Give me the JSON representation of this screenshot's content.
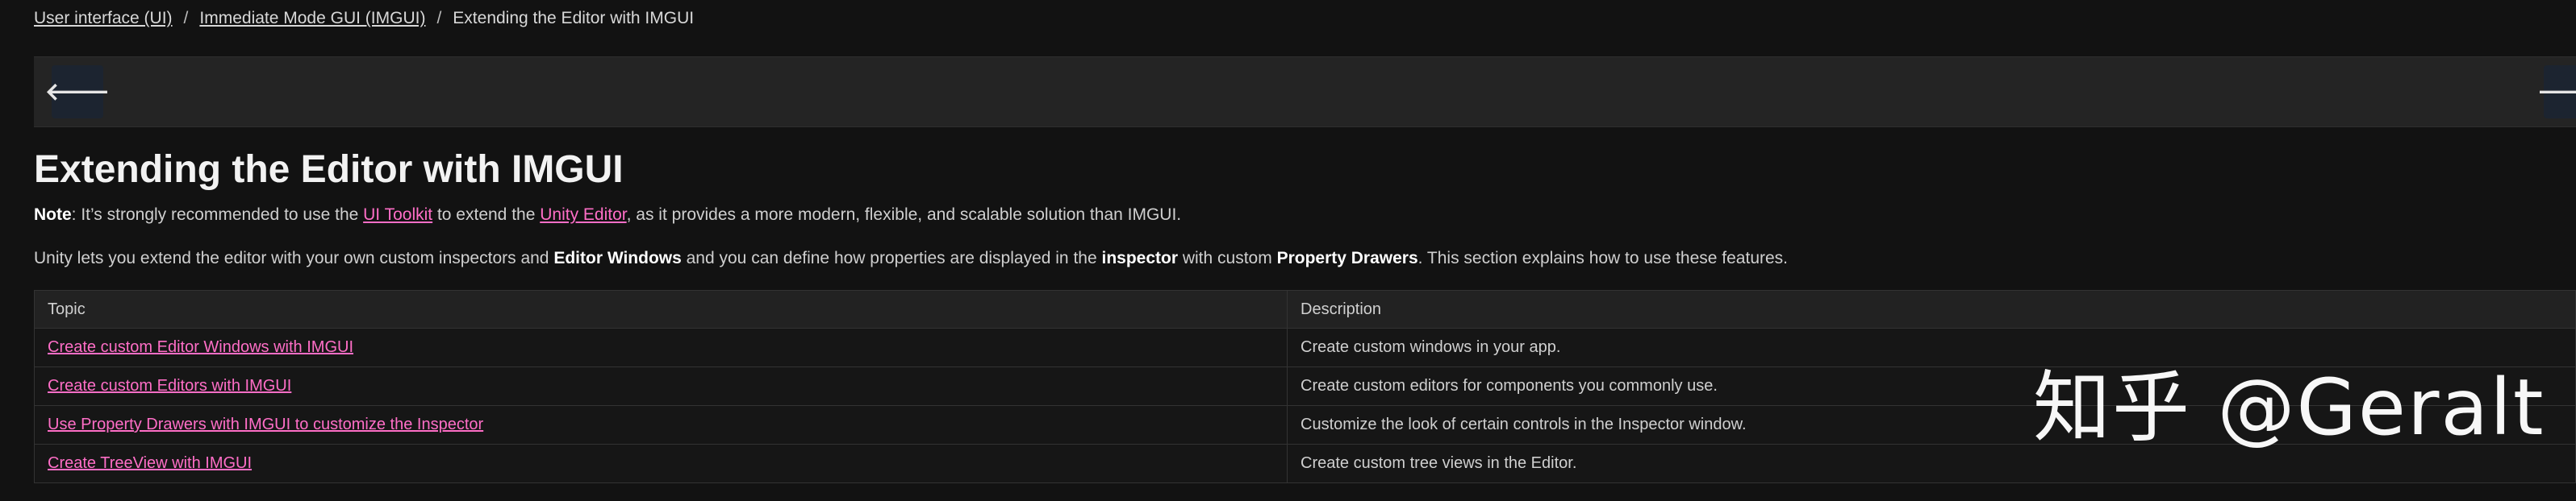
{
  "breadcrumb": {
    "items": [
      "User interface (UI)",
      "Immediate Mode GUI (IMGUI)"
    ],
    "separator": "/",
    "current": "Extending the Editor with IMGUI"
  },
  "nav": {
    "prev_icon": "arrow-left-icon",
    "next_icon": "arrow-right-icon",
    "prev_glyph": "🡐",
    "next_glyph": "🡒"
  },
  "page": {
    "title": "Extending the Editor with IMGUI"
  },
  "note": {
    "label": "Note",
    "part1": ": It’s strongly recommended to use the ",
    "link1": "UI Toolkit",
    "part2": " to extend the ",
    "link2": "Unity Editor",
    "part3": ", as it provides a more modern, flexible, and scalable solution than IMGUI."
  },
  "intro": {
    "part1": "Unity lets you extend the editor with your own custom inspectors and ",
    "bold1": "Editor Windows",
    "part2": " and you can define how properties are displayed in the ",
    "bold2": "inspector",
    "part3": " with custom ",
    "bold3": "Property Drawers",
    "part4": ". This section explains how to use these features."
  },
  "table": {
    "headers": [
      "Topic",
      "Description"
    ],
    "rows": [
      {
        "topic": "Create custom Editor Windows with IMGUI",
        "description": "Create custom windows in your app."
      },
      {
        "topic": "Create custom Editors with IMGUI",
        "description": "Create custom editors for components you commonly use."
      },
      {
        "topic": "Use Property Drawers with IMGUI to customize the Inspector",
        "description": "Customize the look of certain controls in the Inspector window."
      },
      {
        "topic": "Create TreeView with IMGUI",
        "description": "Create custom tree views in the Editor."
      }
    ]
  },
  "watermark": {
    "text": "知乎 @Geralt"
  },
  "colors": {
    "background": "#121212",
    "link_pink": "#ff6ec7",
    "navbar": "#242424",
    "nav_button": "#1c2430"
  }
}
